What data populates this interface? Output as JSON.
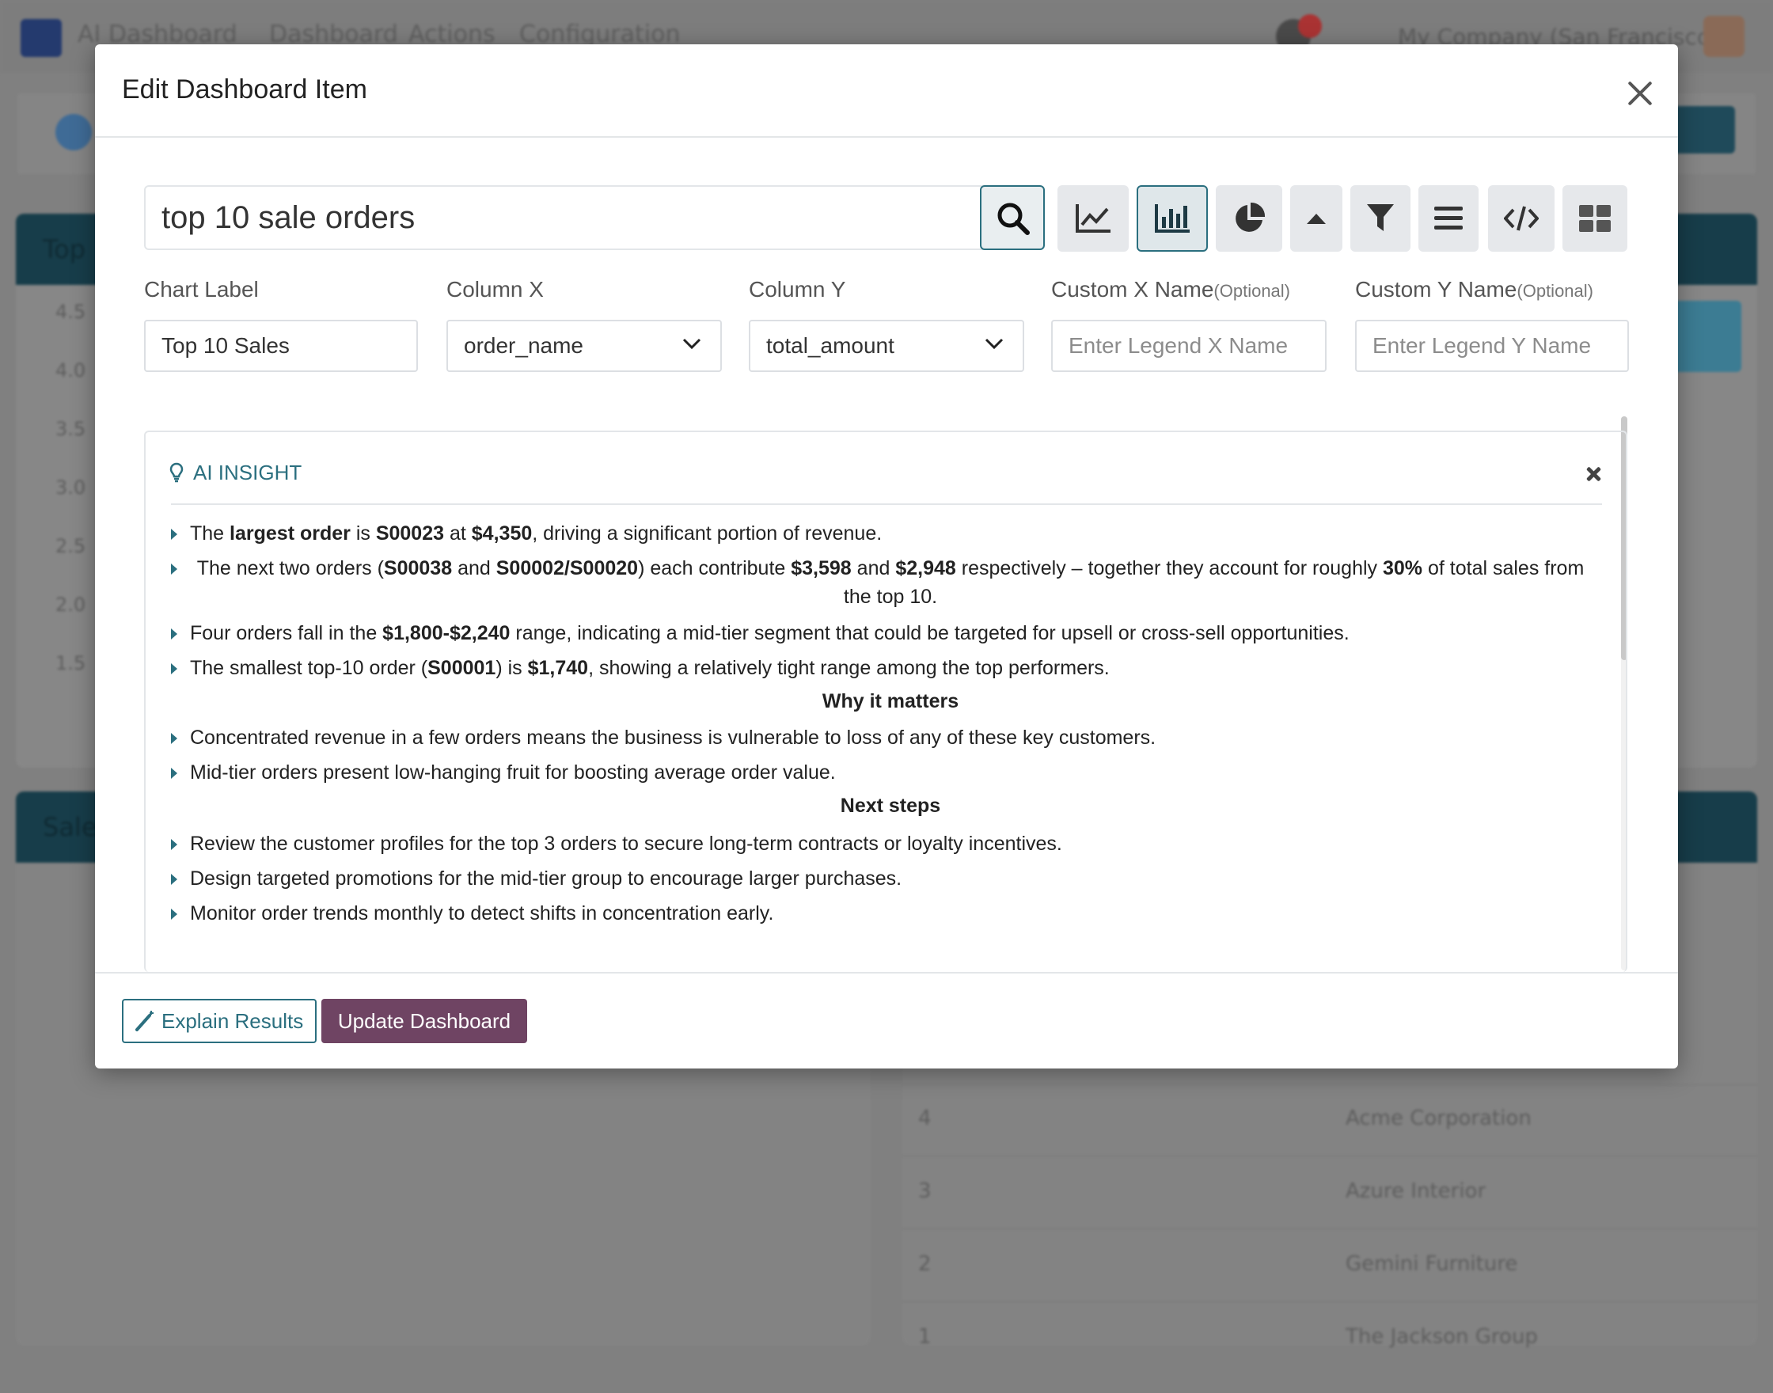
{
  "background": {
    "app_title": "AI Dashboard",
    "nav": [
      "Dashboard",
      "Actions",
      "Configuration"
    ],
    "company": "My Company (San Francisco)",
    "card_left_title": "Top",
    "card_left2_title": "Sales",
    "y_ticks": [
      "4.5",
      "4.0",
      "3.5",
      "3.0",
      "2.5",
      "2.0",
      "1.5"
    ],
    "rows": [
      {
        "num": "4",
        "customer": "Acme Corporation"
      },
      {
        "num": "3",
        "customer": "Azure Interior"
      },
      {
        "num": "2",
        "customer": "Gemini Furniture"
      },
      {
        "num": "1",
        "customer": "The Jackson Group"
      }
    ]
  },
  "modal": {
    "title": "Edit Dashboard Item",
    "search": {
      "value": "top 10 sale orders"
    },
    "toolbar_icons": [
      "search-icon",
      "line-chart-icon",
      "bar-chart-icon",
      "pie-chart-icon",
      "caret-up-icon",
      "filter-icon",
      "list-icon",
      "code-icon",
      "grid-icon"
    ],
    "fields": {
      "chart_label": {
        "label": "Chart Label",
        "value": "Top 10 Sales"
      },
      "column_x": {
        "label": "Column X",
        "value": "order_name"
      },
      "column_y": {
        "label": "Column Y",
        "value": "total_amount"
      },
      "custom_x": {
        "label": "Custom X Name",
        "optional": "(Optional)",
        "placeholder": "Enter Legend X Name"
      },
      "custom_y": {
        "label": "Custom Y Name",
        "optional": "(Optional)",
        "placeholder": "Enter Legend Y Name"
      }
    },
    "insight": {
      "title": "AI INSIGHT",
      "why_heading": "Why it matters",
      "next_heading": "Next steps",
      "why": [
        "Concentrated revenue in a few orders means the business is vulnerable to loss of any of these key customers.",
        "Mid-tier orders present low-hanging fruit for boosting average order value."
      ],
      "next": [
        "Review the customer profiles for the top 3 orders to secure long-term contracts or loyalty incentives.",
        "Design targeted promotions for the mid-tier group to encourage larger purchases.",
        "Monitor order trends monthly to detect shifts in concentration early."
      ],
      "b1": {
        "t1": "The ",
        "b1": "largest order",
        "t2": " is ",
        "b2": "S00023",
        "t3": " at ",
        "b3": "$4,350",
        "t4": ", driving a significant portion of revenue."
      },
      "b2": {
        "t1": "The next two orders (",
        "b1": "S00038",
        "t2": " and ",
        "b2": "S00002/S00020",
        "t3": ") each contribute ",
        "b3": "$3,598",
        "t4": " and ",
        "b4": "$2,948",
        "t5": " respectively – together they account for roughly ",
        "b5": "30%",
        "t6": " of total sales from the top 10."
      },
      "b3": {
        "t1": "Four orders fall in the ",
        "b1": "$1,800-$2,240",
        "t2": " range, indicating a mid-tier segment that could be targeted for upsell or cross-sell opportunities."
      },
      "b4": {
        "t1": "The smallest top-10 order (",
        "b1": "S00001",
        "t2": ") is ",
        "b2": "$1,740",
        "t3": ", showing a relatively tight range among the top performers."
      }
    },
    "buttons": {
      "explain": "Explain Results",
      "update": "Update Dashboard"
    }
  }
}
